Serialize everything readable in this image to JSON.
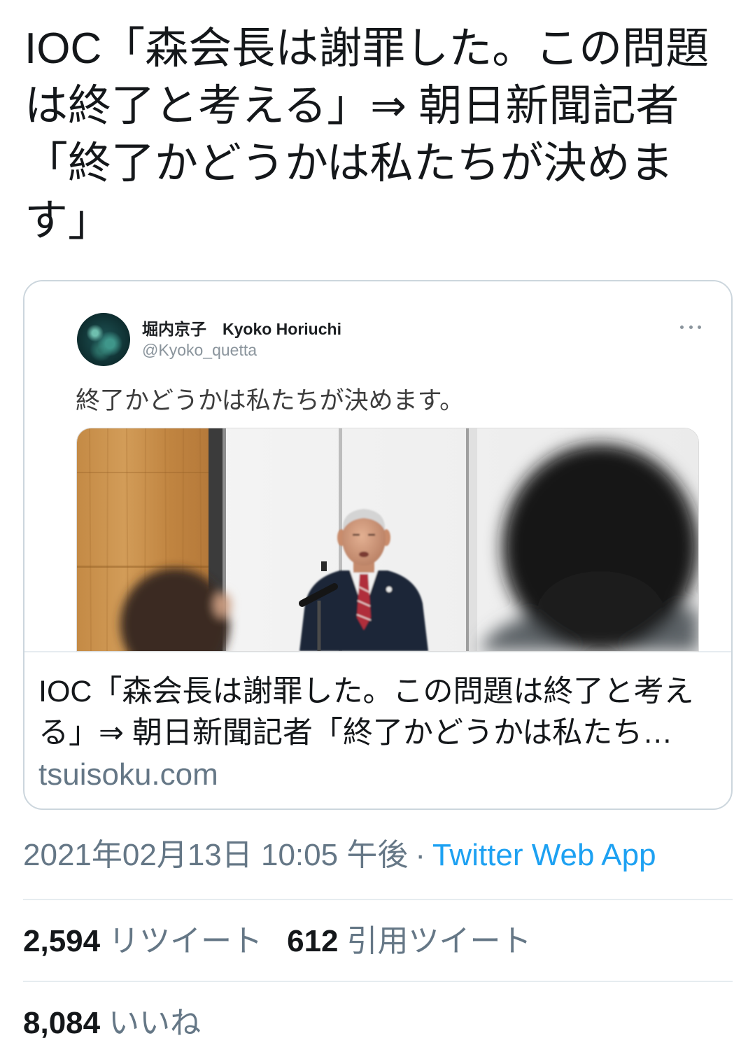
{
  "tweet": {
    "text_lines": [
      "IOC「森会長は謝罪した。この問題",
      "は終了と考える」⇒ 朝日新聞記者",
      "「終了かどうかは私たちが決めま",
      "す」"
    ]
  },
  "card": {
    "embedded_tweet": {
      "display_name": "堀内京子　Kyoko Horiuchi",
      "handle": "@Kyoko_quetta",
      "text": "終了かどうかは私たちが決めます。",
      "more_icon": "more-options-icon"
    },
    "title_lines": [
      "IOC「森会長は謝罪した。この問題は終了と考え",
      "る」⇒ 朝日新聞記者「終了かどうかは私たち…"
    ],
    "domain": "tsuisoku.com"
  },
  "meta": {
    "timestamp": "2021年02月13日 10:05 午後",
    "separator": "·",
    "source": "Twitter Web App"
  },
  "stats": {
    "retweets": {
      "count": "2,594",
      "label": "リツイート"
    },
    "quotes": {
      "count": "612",
      "label": "引用ツイート"
    },
    "likes": {
      "count": "8,084",
      "label": "いいね"
    }
  },
  "colors": {
    "text": "#14171a",
    "secondary": "#657786",
    "accent": "#1da1f2",
    "border": "#ccd6dd",
    "divider": "#e6ecf0"
  }
}
